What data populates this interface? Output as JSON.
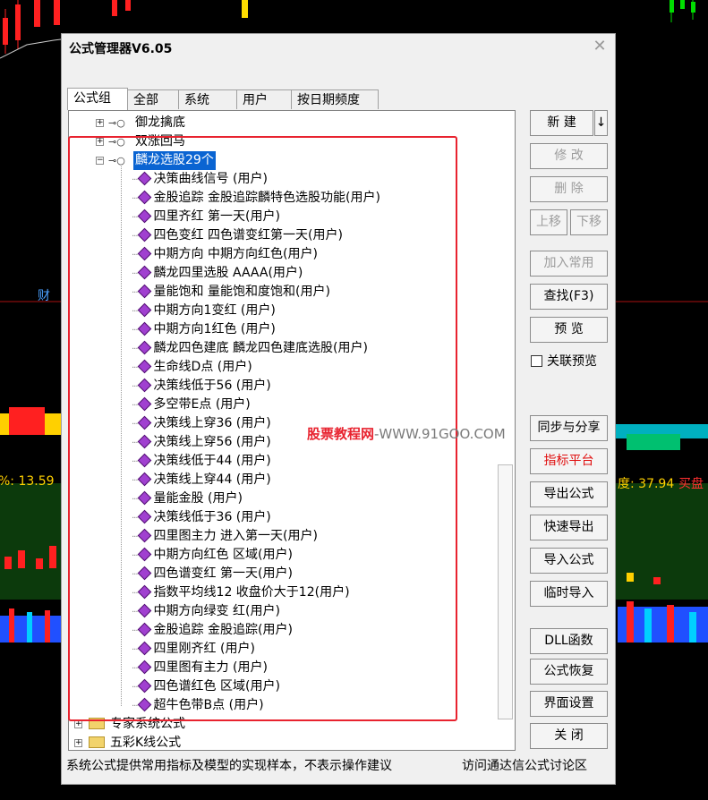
{
  "window": {
    "title": "公式管理器V6.05"
  },
  "tabs": [
    "公式组",
    "全部",
    "系统",
    "用户",
    "按日期频度"
  ],
  "tree": {
    "top_items": [
      "御龙擒底",
      "双涨回马"
    ],
    "selected_group": "麟龙选股29个",
    "children": [
      "决策曲线信号  (用户)",
      "金股追踪  金股追踪麟特色选股功能(用户)",
      "四里齐红  第一天(用户)",
      "四色变红  四色谱变红第一天(用户)",
      "中期方向  中期方向红色(用户)",
      "麟龙四里选股  AAAA(用户)",
      "量能饱和  量能饱和度饱和(用户)",
      "中期方向1变红  (用户)",
      "中期方向1红色  (用户)",
      "麟龙四色建底  麟龙四色建底选股(用户)",
      "生命线D点  (用户)",
      "决策线低于56  (用户)",
      "多空带E点  (用户)",
      "决策线上穿36  (用户)",
      "决策线上穿56  (用户)",
      "决策线低于44  (用户)",
      "决策线上穿44  (用户)",
      "量能金股  (用户)",
      "决策线低于36  (用户)",
      "四里图主力  进入第一天(用户)",
      "中期方向红色  区域(用户)",
      "四色谱变红  第一天(用户)",
      "指数平均线12  收盘价大于12(用户)",
      "中期方向绿变  红(用户)",
      "金股追踪  金股追踪(用户)",
      "四里刚齐红  (用户)",
      "四里图有主力  (用户)",
      "四色谱红色  区域(用户)",
      "超牛色带B点  (用户)"
    ],
    "folders": [
      "专家系统公式",
      "五彩K线公式"
    ]
  },
  "buttons": {
    "new": "新  建",
    "new_arrow": "↓",
    "edit": "修  改",
    "delete": "删  除",
    "move_up": "上移",
    "move_down": "下移",
    "add_common": "加入常用",
    "find": "查找(F3)",
    "preview": "预  览",
    "sync_share": "同步与分享",
    "indicator_platform": "指标平台",
    "export_formula": "导出公式",
    "quick_export": "快速导出",
    "import_formula": "导入公式",
    "temp_import": "临时导入",
    "dll": "DLL函数",
    "restore": "公式恢复",
    "ui_settings": "界面设置",
    "close": "关  闭"
  },
  "linked_preview_label": "关联预览",
  "status": {
    "left": "系统公式提供常用指标及模型的实现样本，不表示操作建议",
    "right": "访问通达信公式讨论区"
  },
  "watermark": {
    "cn": "股票教程网",
    "url": "-WWW.91GOO.COM"
  },
  "background": {
    "label_cai": "财",
    "left_value": "%: 13.59",
    "right_value": "度: 37.94",
    "right_tag": "买盘"
  },
  "colors": {
    "accent_red": "#e8232f",
    "selection": "#0a64d2",
    "icon_purple": "#a040d0"
  }
}
